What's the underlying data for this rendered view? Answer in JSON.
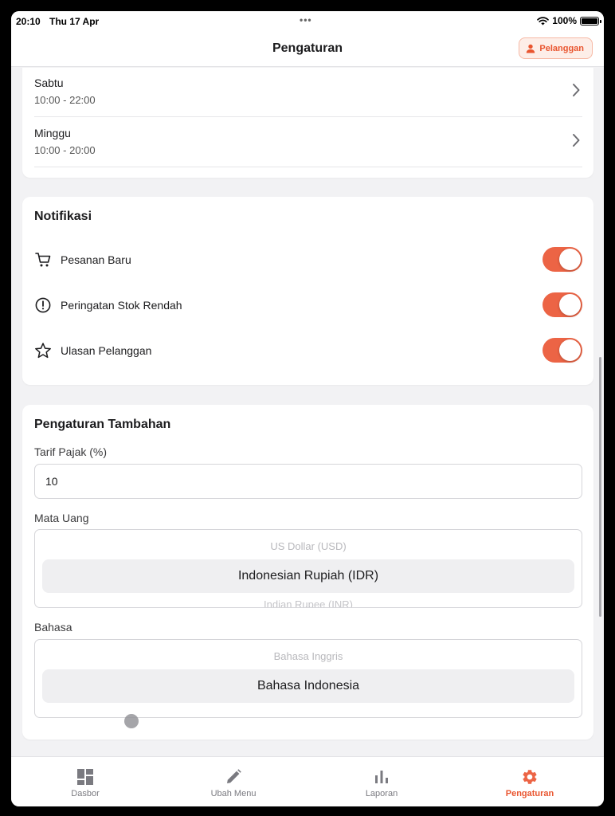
{
  "status_bar": {
    "time": "20:10",
    "date": "Thu 17 Apr",
    "battery": "100%"
  },
  "nav": {
    "title": "Pengaturan",
    "role_label": "Pelanggan"
  },
  "hours": [
    {
      "day": "Sabtu",
      "time": "10:00 - 22:00"
    },
    {
      "day": "Minggu",
      "time": "10:00 - 20:00"
    }
  ],
  "notifications": {
    "title": "Notifikasi",
    "items": [
      {
        "label": "Pesanan Baru",
        "icon": "cart-icon",
        "enabled": true
      },
      {
        "label": "Peringatan Stok Rendah",
        "icon": "alert-circle-icon",
        "enabled": true
      },
      {
        "label": "Ulasan Pelanggan",
        "icon": "star-icon",
        "enabled": true
      }
    ]
  },
  "additional": {
    "title": "Pengaturan Tambahan",
    "tax_label": "Tarif Pajak (%)",
    "tax_value": "10",
    "currency_label": "Mata Uang",
    "currency_options": {
      "above": "US Dollar (USD)",
      "selected": "Indonesian Rupiah (IDR)",
      "below": "Indian Rupee (INR)"
    },
    "language_label": "Bahasa",
    "language_options": {
      "above": "Bahasa Inggris",
      "selected": "Bahasa Indonesia"
    }
  },
  "tabs": [
    {
      "label": "Dasbor",
      "icon": "dashboard-icon",
      "active": false
    },
    {
      "label": "Ubah Menu",
      "icon": "pencil-icon",
      "active": false
    },
    {
      "label": "Laporan",
      "icon": "bar-chart-icon",
      "active": false
    },
    {
      "label": "Pengaturan",
      "icon": "gear-icon",
      "active": true
    }
  ],
  "colors": {
    "accent": "#EC6445",
    "accent_text": "#E9552F",
    "background": "#F2F2F4"
  }
}
